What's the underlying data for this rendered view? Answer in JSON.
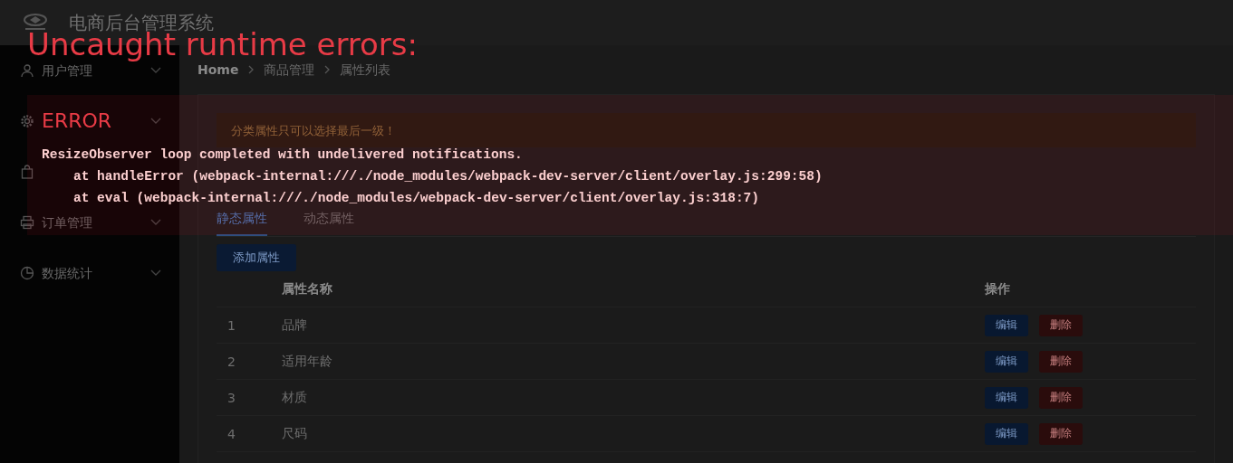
{
  "header": {
    "title": "电商后台管理系统"
  },
  "sidebar": {
    "items": [
      {
        "kind": "labelled",
        "label": "用户管理"
      },
      {
        "kind": "labelless"
      },
      {
        "kind": "icon"
      },
      {
        "kind": "labelled",
        "label": "订单管理"
      },
      {
        "kind": "labelled",
        "label": "数据统计"
      }
    ]
  },
  "breadcrumb": [
    "Home",
    "商品管理",
    "属性列表"
  ],
  "alert": "分类属性只可以选择最后一级！",
  "tabs": [
    {
      "label": "静态属性",
      "selected": true
    },
    {
      "label": "动态属性",
      "selected": false
    }
  ],
  "add_button": "添加属性",
  "table": {
    "columns": [
      "属性名称",
      "操作"
    ],
    "rows": [
      {
        "index": "1",
        "name": "品牌",
        "actions": [
          "编辑",
          "删除"
        ]
      },
      {
        "index": "2",
        "name": "适用年龄",
        "actions": [
          "编辑",
          "删除"
        ]
      },
      {
        "index": "3",
        "name": "材质",
        "actions": [
          "编辑",
          "删除"
        ]
      },
      {
        "index": "4",
        "name": "尺码",
        "actions": [
          "编辑",
          "删除"
        ]
      }
    ]
  },
  "overlay": {
    "title": "Uncaught runtime errors:",
    "errors": [
      {
        "heading": "ERROR",
        "message": "ResizeObserver loop completed with undelivered notifications.",
        "stack": [
          "at handleError (webpack-internal:///./node_modules/webpack-dev-server/client/overlay.js:299:58)",
          "at eval (webpack-internal:///./node_modules/webpack-dev-server/client/overlay.js:318:7)"
        ]
      }
    ]
  }
}
